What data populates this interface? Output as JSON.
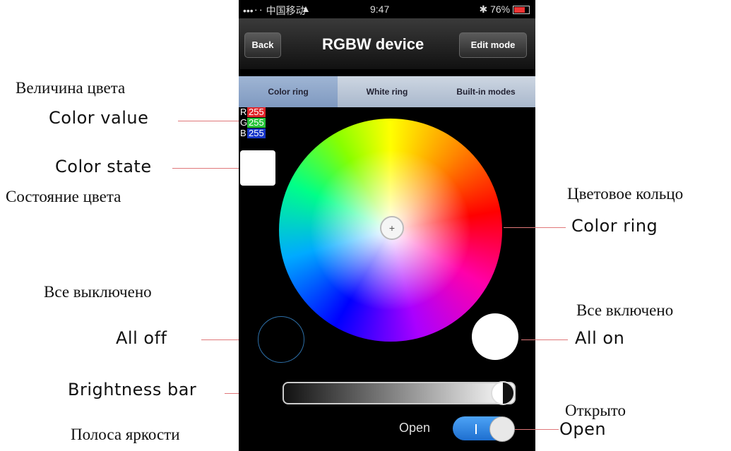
{
  "status": {
    "carrier": "•••‥ 中国移动",
    "wifi_icon": "▲",
    "time": "9:47",
    "bt_icon": "✱",
    "battery": "76%"
  },
  "header": {
    "back": "Back",
    "title": "RGBW device",
    "edit": "Edit mode"
  },
  "tabs": [
    {
      "label": "Color ring",
      "active": true
    },
    {
      "label": "White ring",
      "active": false
    },
    {
      "label": "Built-in modes",
      "active": false
    }
  ],
  "color_values": [
    {
      "channel": "R",
      "value": "255",
      "color": "#e0262b"
    },
    {
      "channel": "G",
      "value": "255",
      "color": "#27c43a"
    },
    {
      "channel": "B",
      "value": "255",
      "color": "#1736c8"
    }
  ],
  "ring_center_glyph": "+",
  "toggle": {
    "label": "Open",
    "on": true,
    "mark": "|"
  },
  "annotations": {
    "color_value_ru": "Величина цвета",
    "color_value_en": "Color value",
    "color_state_en": "Color state",
    "color_state_ru": "Состояние цвета",
    "color_ring_ru": "Цветовое кольцо",
    "color_ring_en": "Color ring",
    "all_off_ru": "Все выключено",
    "all_off_en": "All  off",
    "all_on_ru": "Все включено",
    "all_on_en": "All  on",
    "brightness_en": "Brightness bar",
    "brightness_ru": "Полоса яркости",
    "open_ru": "Открыто",
    "open_en": "Open"
  }
}
